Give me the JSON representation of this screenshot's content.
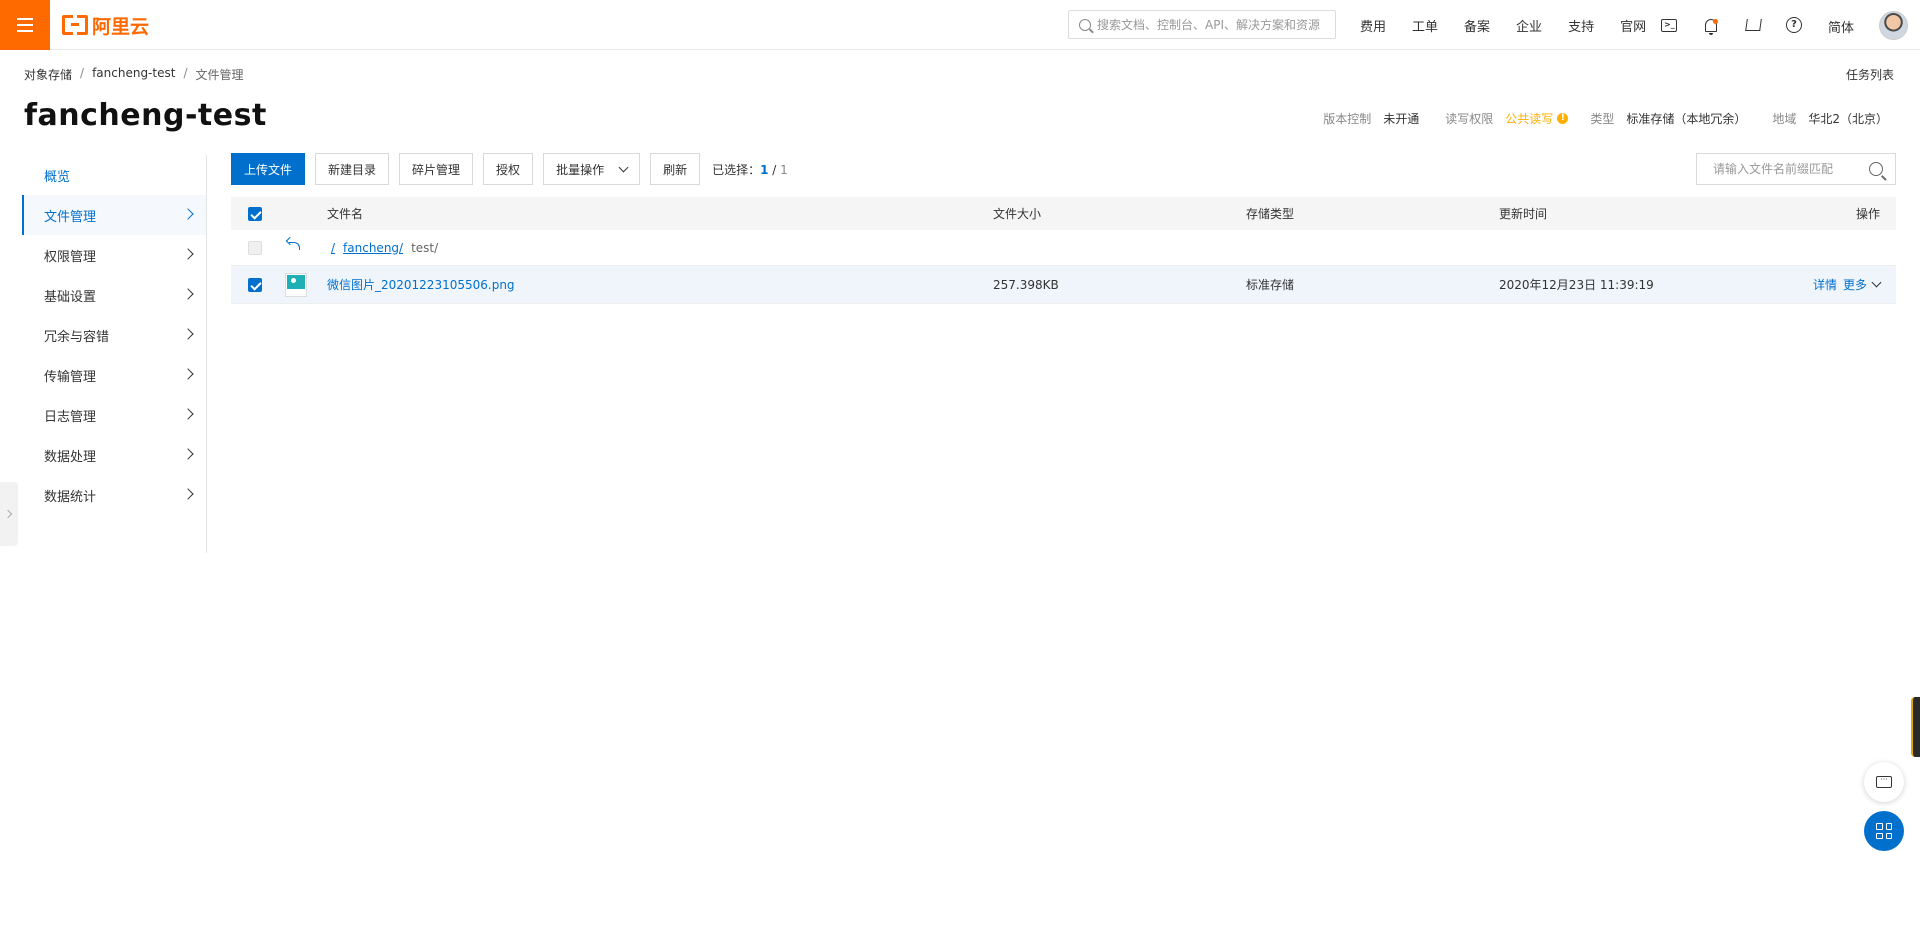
{
  "brand": {
    "logo_text": "阿里云"
  },
  "search": {
    "placeholder": "搜索文档、控制台、API、解决方案和资源"
  },
  "topnav": [
    "费用",
    "工单",
    "备案",
    "企业",
    "支持",
    "官网"
  ],
  "lang": "简体",
  "icons": {
    "terminal": "terminal-icon",
    "bell": "bell-icon",
    "cart": "cart-icon",
    "help": "help-icon"
  },
  "breadcrumb": [
    "对象存储",
    "fancheng-test",
    "文件管理"
  ],
  "task_list": "任务列表",
  "bucket": {
    "name": "fancheng-test",
    "meta": {
      "version_label": "版本控制",
      "version_value": "未开通",
      "acl_label": "读写权限",
      "acl_value": "公共读写",
      "acl_warn": "!",
      "type_label": "类型",
      "type_value": "标准存储（本地冗余）",
      "region_label": "地域",
      "region_value": "华北2（北京）"
    }
  },
  "sidebar": {
    "items": [
      {
        "label": "概览"
      },
      {
        "label": "文件管理"
      },
      {
        "label": "权限管理"
      },
      {
        "label": "基础设置"
      },
      {
        "label": "冗余与容错"
      },
      {
        "label": "传输管理"
      },
      {
        "label": "日志管理"
      },
      {
        "label": "数据处理"
      },
      {
        "label": "数据统计"
      }
    ]
  },
  "toolbar": {
    "upload": "上传文件",
    "new_dir": "新建目录",
    "fragments": "碎片管理",
    "authorize": "授权",
    "batch": "批量操作",
    "refresh": "刷新",
    "selected_label": "已选择：",
    "selected_count": "1",
    "selected_sep": " / ",
    "selected_total": "1"
  },
  "filter": {
    "placeholder": "请输入文件名前缀匹配"
  },
  "table": {
    "headers": {
      "name": "文件名",
      "size": "文件大小",
      "type": "存储类型",
      "time": "更新时间",
      "op": "操作"
    },
    "path": {
      "root": "/",
      "parent": "fancheng/",
      "current": "test/"
    },
    "rows": [
      {
        "name": "微信图片_20201223105506.png",
        "size": "257.398KB",
        "type": "标准存储",
        "time": "2020年12月23日 11:39:19",
        "detail": "详情",
        "more": "更多"
      }
    ]
  },
  "colors": {
    "brand": "#ff6a00",
    "primary": "#0070cc",
    "warning": "#ffb000"
  }
}
